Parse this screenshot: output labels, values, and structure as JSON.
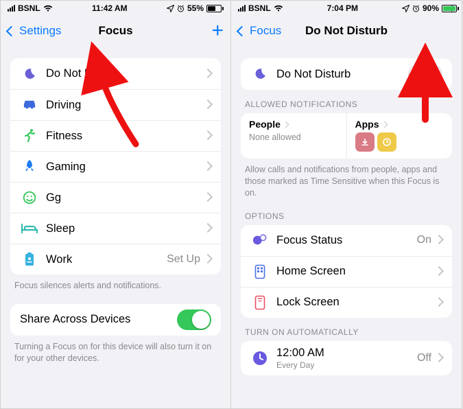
{
  "left": {
    "status": {
      "carrier": "BSNL",
      "time": "11:42 AM",
      "battery_pct": "55%",
      "battery_fill": 55
    },
    "nav_back": "Settings",
    "nav_title": "Focus",
    "focus_items": [
      {
        "icon": "moon",
        "label": "Do Not Disturb",
        "accessory": "chev"
      },
      {
        "icon": "car",
        "label": "Driving",
        "accessory": "chev"
      },
      {
        "icon": "runner",
        "label": "Fitness",
        "accessory": "chev"
      },
      {
        "icon": "rocket",
        "label": "Gaming",
        "accessory": "chev"
      },
      {
        "icon": "smiley",
        "label": "Gg",
        "accessory": "chev"
      },
      {
        "icon": "bed",
        "label": "Sleep",
        "accessory": "chev"
      },
      {
        "icon": "work",
        "label": "Work",
        "value": "Set Up",
        "accessory": "chev"
      }
    ],
    "footer1": "Focus silences alerts and notifications.",
    "share_label": "Share Across Devices",
    "share_on": true,
    "footer2": "Turning a Focus on for this device will also turn it on for your other devices."
  },
  "right": {
    "status": {
      "carrier": "BSNL",
      "time": "7:04 PM",
      "battery_pct": "90%",
      "battery_fill": 90
    },
    "nav_back": "Focus",
    "nav_title": "Do Not Disturb",
    "dnd_label": "Do Not Disturb",
    "dnd_on": false,
    "section_allowed": "ALLOWED NOTIFICATIONS",
    "people_label": "People",
    "people_sub": "None allowed",
    "apps_label": "Apps",
    "allowed_footer": "Allow calls and notifications from people, apps and those marked as Time Sensitive when this Focus is on.",
    "section_options": "OPTIONS",
    "option_focus_status": "Focus Status",
    "option_focus_status_value": "On",
    "option_home": "Home Screen",
    "option_lock": "Lock Screen",
    "section_auto": "TURN ON AUTOMATICALLY",
    "auto_time": "12:00 AM",
    "auto_sub": "Every Day",
    "auto_value": "Off"
  }
}
